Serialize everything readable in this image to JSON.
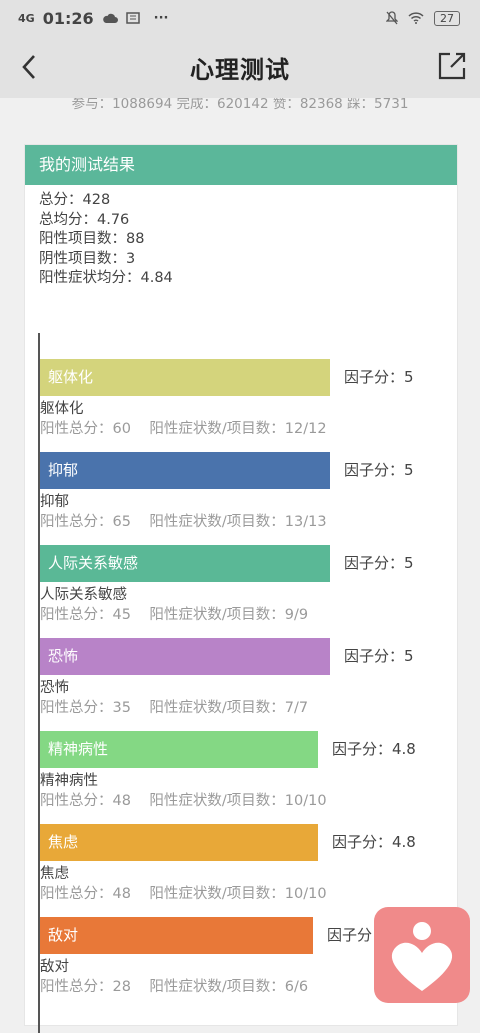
{
  "status": {
    "signal": "4G",
    "time": "01:26",
    "more": "···",
    "battery": "27"
  },
  "nav": {
    "title": "心理测试"
  },
  "stats_line": "参与：1088694 完成：620142 赞：82368 踩：5731",
  "result": {
    "header": "我的测试结果",
    "lines": [
      "总分：428",
      "总均分：4.76",
      "阳性项目数：88",
      "阴性项目数：3",
      "阳性症状均分：4.84"
    ]
  },
  "factors": [
    {
      "name": "躯体化",
      "score_label": "因子分：5",
      "score": 5,
      "detail": "阳性总分：60    阳性症状数/项目数：12/12",
      "color": "#d4d47c"
    },
    {
      "name": "抑郁",
      "score_label": "因子分：5",
      "score": 5,
      "detail": "阳性总分：65    阳性症状数/项目数：13/13",
      "color": "#4a73ac"
    },
    {
      "name": "人际关系敏感",
      "score_label": "因子分：5",
      "score": 5,
      "detail": "阳性总分：45    阳性症状数/项目数：9/9",
      "color": "#5ab896"
    },
    {
      "name": "恐怖",
      "score_label": "因子分：5",
      "score": 5,
      "detail": "阳性总分：35    阳性症状数/项目数：7/7",
      "color": "#b883c8"
    },
    {
      "name": "精神病性",
      "score_label": "因子分：4.8",
      "score": 4.8,
      "detail": "阳性总分：48    阳性症状数/项目数：10/10",
      "color": "#84d884"
    },
    {
      "name": "焦虑",
      "score_label": "因子分：4.8",
      "score": 4.8,
      "detail": "阳性总分：48    阳性症状数/项目数：10/10",
      "color": "#e8a838"
    },
    {
      "name": "敌对",
      "score_label": "因子分",
      "score": 4.7,
      "detail": "阳性总分：28    阳性症状数/项目数：6/6",
      "color": "#e87838"
    }
  ],
  "colors": {
    "accent": "#5bb79a",
    "float_button": "#f08a8a"
  }
}
